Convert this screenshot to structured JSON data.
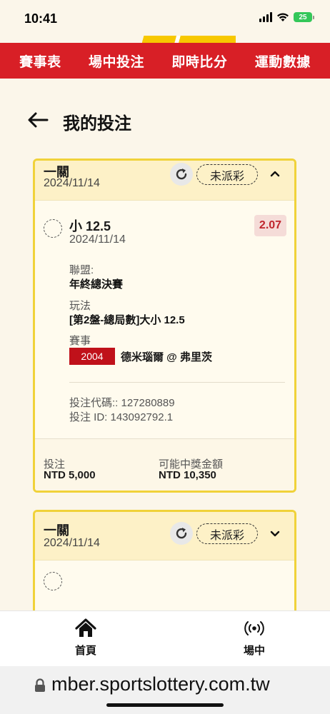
{
  "status_bar": {
    "time": "10:41",
    "battery": "25"
  },
  "top_nav": [
    "賽事表",
    "場中投注",
    "即時比分",
    "運動數據"
  ],
  "header": {
    "title": "我的投注"
  },
  "bets": [
    {
      "type": "一關",
      "date": "2024/11/14",
      "status": "未派彩",
      "expanded": true,
      "selection": {
        "title": "小 12.5",
        "date": "2024/11/14",
        "odds": "2.07",
        "league_label": "聯盟:",
        "league": "年終總決賽",
        "market_label": "玩法",
        "market": "[第2盤-總局數]大小 12.5",
        "event_label": "賽事",
        "event_code": "2004",
        "event_name": "德米瑙爾 @ 弗里茨",
        "bet_code": "投注代碼:: 127280889",
        "bet_id": "投注 ID: 143092792.1"
      },
      "stake_label": "投注",
      "stake": "NTD 5,000",
      "payout_label": "可能中獎金額",
      "payout": "NTD 10,350"
    },
    {
      "type": "一關",
      "date": "2024/11/14",
      "status": "未派彩",
      "expanded": false
    }
  ],
  "tab_bar": [
    {
      "label": "首頁",
      "icon": "home-icon"
    },
    {
      "label": "場中",
      "icon": "live-broadcast-icon"
    }
  ],
  "url_bar": {
    "url": "mber.sportslottery.com.tw"
  }
}
